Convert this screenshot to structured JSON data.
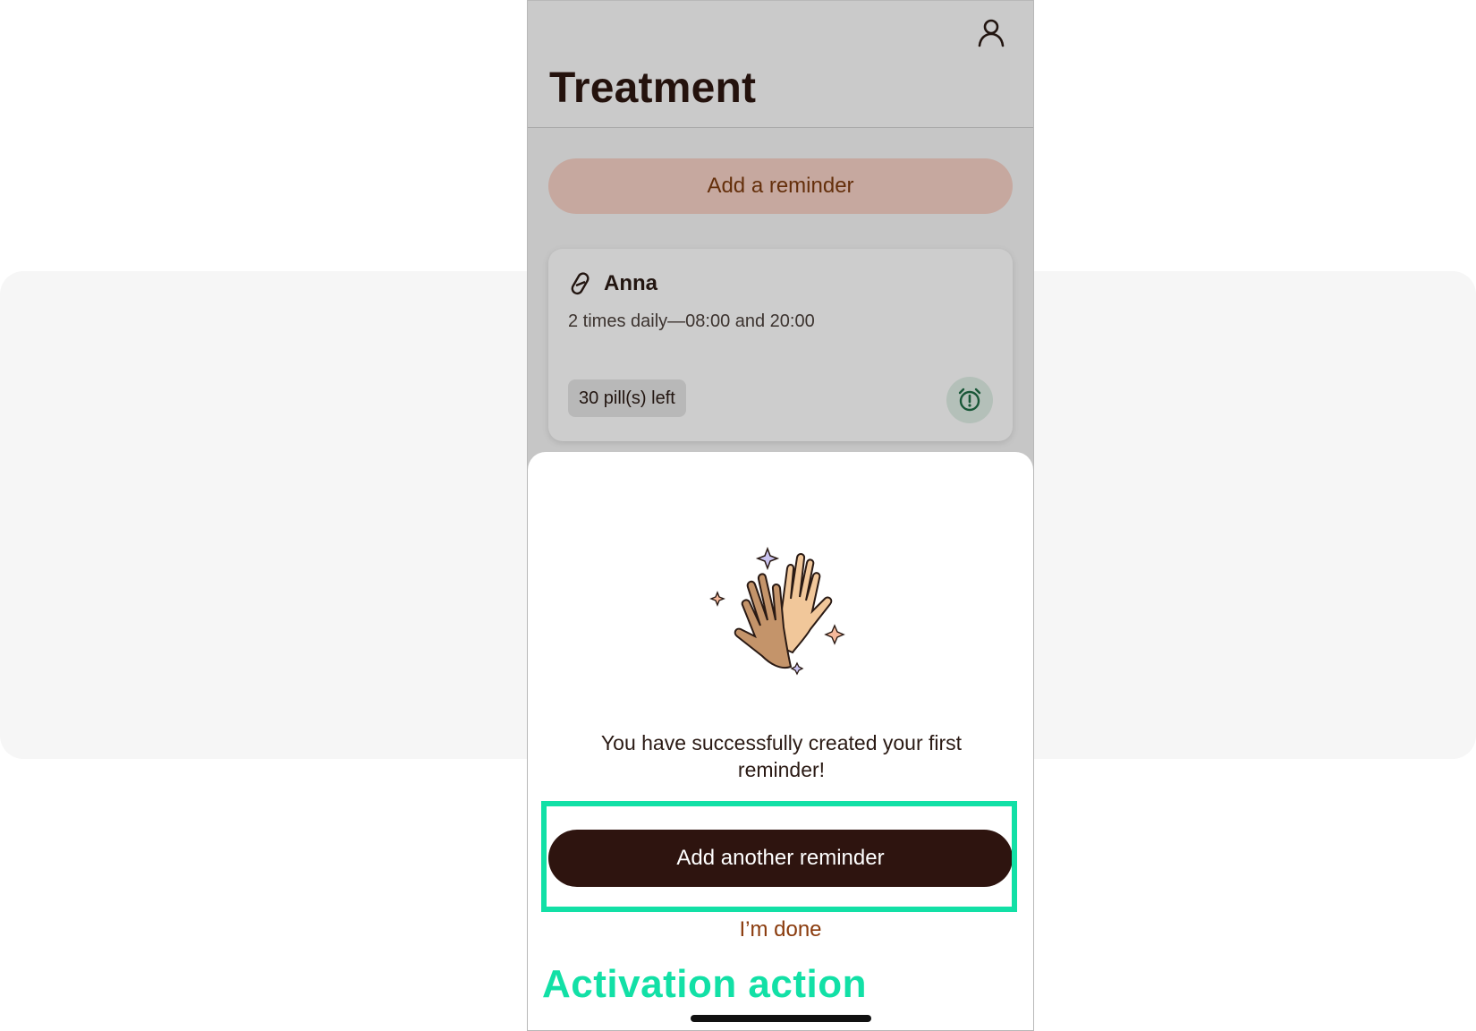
{
  "header": {
    "title": "Treatment",
    "profile_icon": "person-icon"
  },
  "main": {
    "add_reminder_label": "Add a reminder",
    "reminder_card": {
      "icon": "pill-icon",
      "name": "Anna",
      "schedule": "2 times daily—08:00 and 20:00",
      "pills_left": "30 pill(s) left",
      "alarm_icon": "alarm-clock-icon"
    }
  },
  "sheet": {
    "illustration": "high-five-hands",
    "message": "You have successfully created your first reminder!",
    "primary_button_label": "Add another reminder",
    "secondary_link_label": "I’m done"
  },
  "annotation": {
    "label": "Activation action",
    "color": "#12e0a6"
  },
  "colors": {
    "brand_dark": "#2e140f",
    "brand_accent": "#8a3b0d",
    "add_button_bg": "#f2cdc2",
    "alarm_green": "#1f6b45"
  }
}
